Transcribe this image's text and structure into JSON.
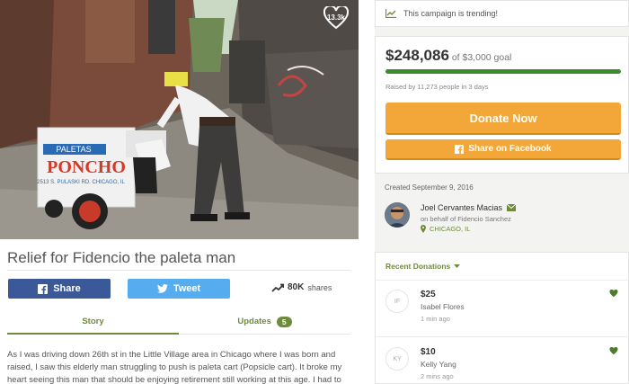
{
  "hero": {
    "heart_count": "13.3k"
  },
  "campaign": {
    "title": "Relief for Fidencio the paleta man",
    "share_facebook_label": "Share",
    "share_twitter_label": "Tweet",
    "shares_count": "80K",
    "shares_label": "shares",
    "tabs": {
      "story": "Story",
      "updates": "Updates",
      "updates_count": "5"
    },
    "story_text": "As I was driving down 26th st in the Little Village area in Chicago where I was born and raised, I saw this elderly man struggling to push is paleta cart (Popsicle cart). It broke my heart seeing this man that should be enjoying retirement still working at this age. I had to"
  },
  "sidebar": {
    "trending_text": "This campaign is trending!",
    "raised_amount": "$248,086",
    "goal_text": "of $3,000 goal",
    "progress_fraction": 1.0,
    "raised_by": "Raised by 11,273 people in 3 days",
    "donate_label": "Donate Now",
    "facebook_share_label": "Share on Facebook",
    "created": "Created September 9, 2016",
    "organizer": {
      "name": "Joel Cervantes Macias",
      "behalf": "on behalf of Fidencio Sanchez",
      "location": "CHICAGO, IL"
    },
    "recent_donations_label": "Recent Donations",
    "donations": [
      {
        "initials": "IF",
        "amount": "$25",
        "name": "Isabel Flores",
        "time": "1 min ago"
      },
      {
        "initials": "KY",
        "amount": "$10",
        "name": "Kelly Yang",
        "time": "2 mins ago"
      }
    ]
  },
  "colors": {
    "accent_green": "#6e8b3d",
    "progress_green": "#3c8c2f",
    "donate_orange": "#f2a738",
    "facebook_blue": "#3b5998",
    "twitter_blue": "#55acee"
  }
}
